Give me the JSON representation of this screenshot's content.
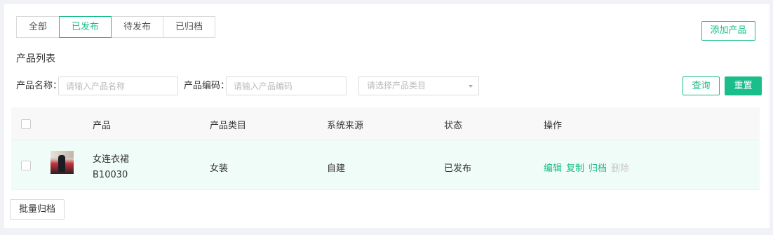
{
  "tabs": [
    {
      "label": "全部"
    },
    {
      "label": "已发布"
    },
    {
      "label": "待发布"
    },
    {
      "label": "已归档"
    }
  ],
  "active_tab": "已发布",
  "add_product_label": "添加产品",
  "section_title": "产品列表",
  "filters": {
    "name_label": "产品名称：",
    "name_placeholder": "请输入产品名称",
    "code_label": "产品编码：",
    "code_placeholder": "请输入产品编码",
    "category_placeholder": "请选择产品类目",
    "query_label": "查询",
    "reset_label": "重置"
  },
  "table": {
    "headers": {
      "product": "产品",
      "category": "产品类目",
      "source": "系统来源",
      "status": "状态",
      "actions": "操作"
    },
    "rows": [
      {
        "name": "女连衣裙",
        "code": "B10030",
        "category": "女装",
        "source": "自建",
        "status": "已发布",
        "actions": {
          "edit": "编辑",
          "copy": "复制",
          "archive": "归档",
          "delete": "删除"
        }
      }
    ]
  },
  "batch_archive_label": "批量归档",
  "colors": {
    "accent": "#19be8b",
    "row_highlight": "#f0fcf7",
    "disabled": "#c8c8c8"
  }
}
